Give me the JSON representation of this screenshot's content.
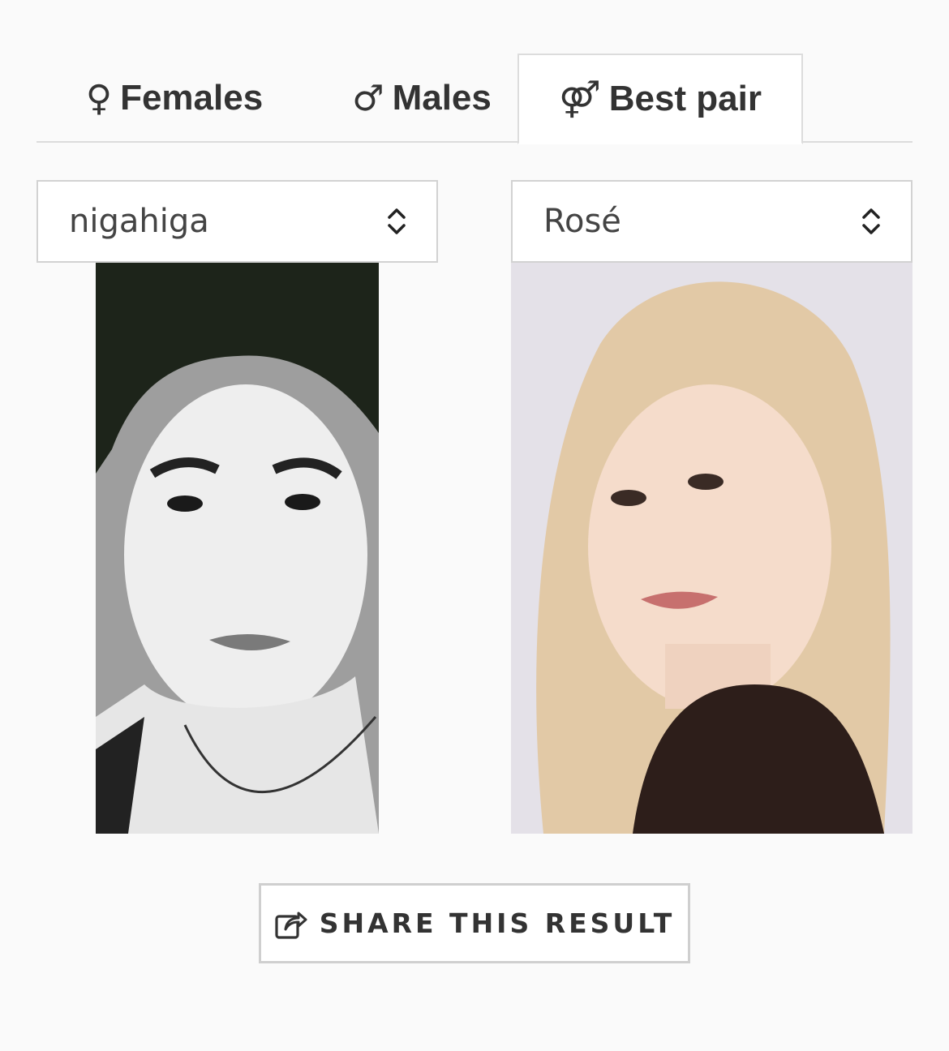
{
  "tabs": [
    {
      "glyph": "♀",
      "label": "Females",
      "active": false
    },
    {
      "glyph": "♂",
      "label": "Males",
      "active": false
    },
    {
      "glyph": "⚤",
      "label": "Best pair",
      "active": true
    }
  ],
  "selects": {
    "left": {
      "value": "nigahiga"
    },
    "right": {
      "value": "Rosé"
    }
  },
  "icons": {
    "select_arrows": "chevron-up-down-icon",
    "share": "share-icon"
  },
  "share_button": {
    "label": "SHARE THIS RESULT"
  },
  "colors": {
    "background": "#fafafa",
    "tab_border": "#dcdcdc",
    "text": "#333333"
  }
}
